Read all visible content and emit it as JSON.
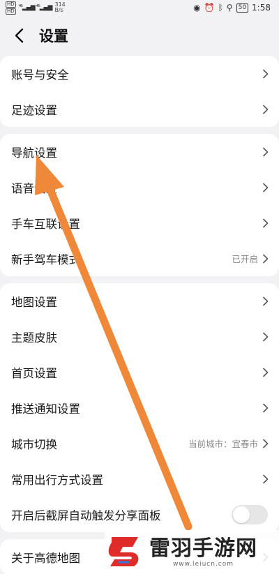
{
  "status_bar": {
    "sim1": "HD",
    "sim2": "HD",
    "speed_value": "314",
    "speed_unit": "B/s",
    "battery": "50",
    "time": "1:58"
  },
  "header": {
    "title": "设置"
  },
  "groups": [
    {
      "rows": [
        {
          "label": "账号与安全",
          "value": ""
        },
        {
          "label": "足迹设置",
          "value": ""
        }
      ]
    },
    {
      "rows": [
        {
          "label": "导航设置",
          "value": ""
        },
        {
          "label": "语音设置",
          "value": ""
        },
        {
          "label": "手车互联设置",
          "value": ""
        },
        {
          "label": "新手驾车模式",
          "value": "已开启"
        }
      ]
    },
    {
      "rows": [
        {
          "label": "地图设置",
          "value": ""
        },
        {
          "label": "主题皮肤",
          "value": ""
        },
        {
          "label": "首页设置",
          "value": ""
        },
        {
          "label": "推送通知设置",
          "value": ""
        },
        {
          "label": "城市切换",
          "value": "当前城市：宜春市"
        },
        {
          "label": "常用出行方式设置",
          "value": ""
        },
        {
          "label": "开启后截屏自动触发分享面板",
          "value": "",
          "toggle_on": false
        }
      ]
    },
    {
      "rows": [
        {
          "label": "关于高德地图",
          "value": ""
        }
      ]
    }
  ],
  "watermark": {
    "title": "雷羽手游网",
    "url": "www.leiucn.com"
  },
  "colors": {
    "arrow": "#f0883a",
    "page_bg": "#f2f2f4",
    "card_bg": "#ffffff"
  }
}
